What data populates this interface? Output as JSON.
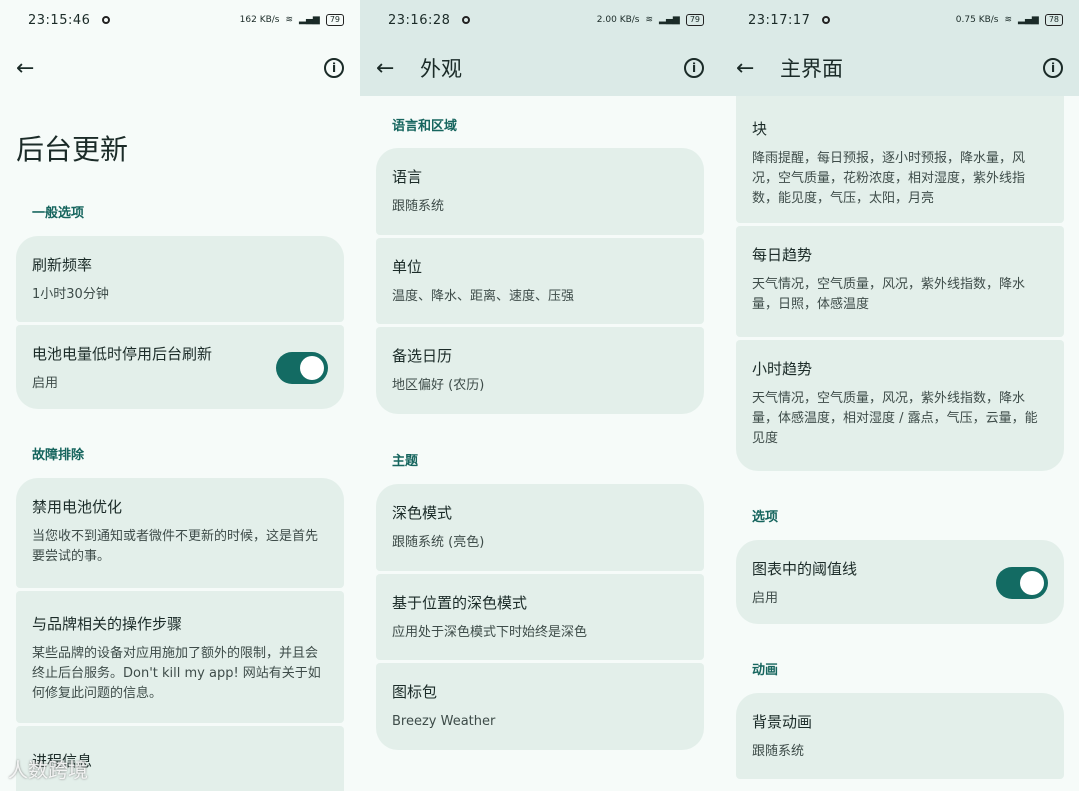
{
  "screen1": {
    "status": {
      "time": "23:15:46",
      "speed": "162 KB/s",
      "battery": "79"
    },
    "title": "后台更新",
    "section_general": "一般选项",
    "refresh": {
      "title": "刷新频率",
      "value": "1小时30分钟"
    },
    "battery_low": {
      "title": "电池电量低时停用后台刷新",
      "value": "启用"
    },
    "section_trouble": "故障排除",
    "disable_opt": {
      "title": "禁用电池优化",
      "desc": "当您收不到通知或者微件不更新的时候，这是首先要尝试的事。"
    },
    "brand_steps": {
      "title": "与品牌相关的操作步骤",
      "desc": "某些品牌的设备对应用施加了额外的限制，并且会终止后台服务。Don't kill my app! 网站有关于如何修复此问题的信息。"
    },
    "process_info": {
      "title": "进程信息"
    },
    "watermark": "人数跨境"
  },
  "screen2": {
    "status": {
      "time": "23:16:28",
      "speed": "2.00 KB/s",
      "battery": "79"
    },
    "title": "外观",
    "section_lang": "语言和区域",
    "language": {
      "title": "语言",
      "value": "跟随系统"
    },
    "units": {
      "title": "单位",
      "value": "温度、降水、距离、速度、压强"
    },
    "calendar": {
      "title": "备选日历",
      "value": "地区偏好 (农历)"
    },
    "section_theme": "主题",
    "dark_mode": {
      "title": "深色模式",
      "value": "跟随系统 (亮色)"
    },
    "loc_dark": {
      "title": "基于位置的深色模式",
      "value": "应用处于深色模式下时始终是深色"
    },
    "icon_pack": {
      "title": "图标包",
      "value": "Breezy Weather"
    }
  },
  "screen3": {
    "status": {
      "time": "23:17:17",
      "speed": "0.75 KB/s",
      "battery": "78"
    },
    "title": "主界面",
    "blocks": {
      "title": "块",
      "value": "降雨提醒，每日预报，逐小时预报，降水量，风况，空气质量，花粉浓度，相对湿度，紫外线指数，能见度，气压，太阳，月亮"
    },
    "daily": {
      "title": "每日趋势",
      "value": "天气情况，空气质量，风况，紫外线指数，降水量，日照，体感温度"
    },
    "hourly": {
      "title": "小时趋势",
      "value": "天气情况，空气质量，风况，紫外线指数，降水量，体感温度，相对湿度 / 露点，气压，云量，能见度"
    },
    "section_options": "选项",
    "threshold": {
      "title": "图表中的阈值线",
      "value": "启用"
    },
    "section_anim": "动画",
    "bg_anim": {
      "title": "背景动画",
      "value": "跟随系统"
    }
  },
  "colors": {
    "accent": "#136b63",
    "card": "#e3efea",
    "header": "#dbeae7"
  }
}
